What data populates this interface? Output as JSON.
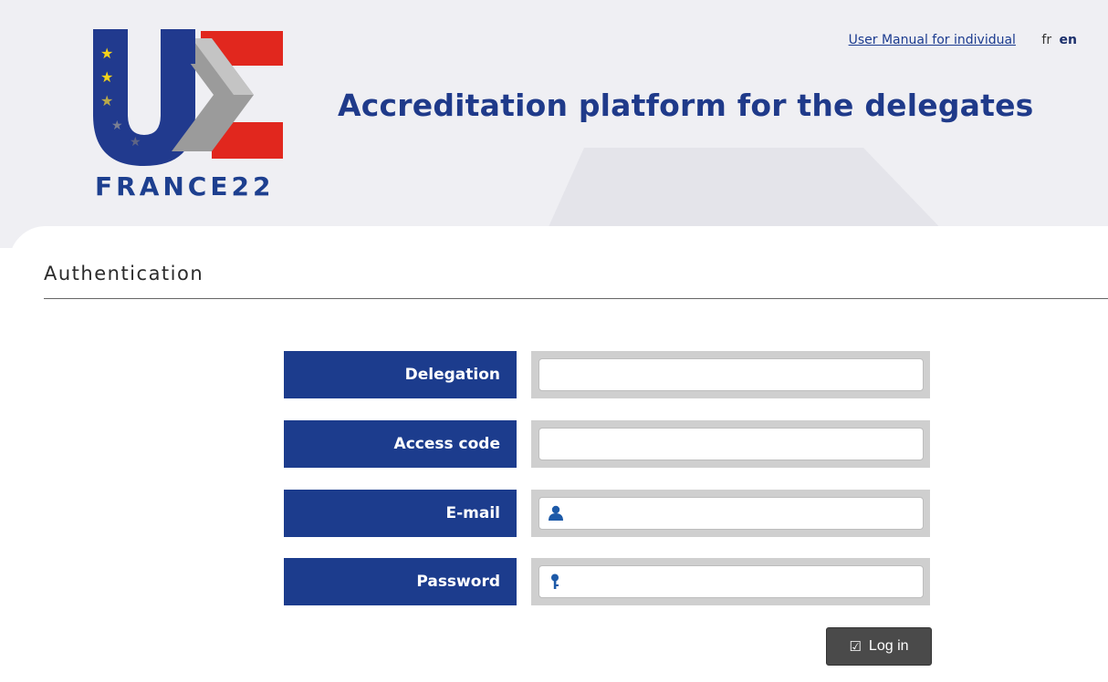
{
  "header": {
    "logo_text": "FRANCE22",
    "user_manual_link": "User Manual for individual",
    "languages": [
      "fr",
      "en"
    ],
    "active_language": "en",
    "title": "Accreditation platform for the delegates"
  },
  "section": {
    "title": "Authentication"
  },
  "form": {
    "fields": [
      {
        "label": "Delegation",
        "value": "",
        "icon": ""
      },
      {
        "label": "Access code",
        "value": "",
        "icon": ""
      },
      {
        "label": "E-mail",
        "value": "",
        "icon": "user-icon"
      },
      {
        "label": "Password",
        "value": "",
        "icon": "key-icon"
      }
    ],
    "login_button": "Log in"
  },
  "colors": {
    "brand_blue": "#1c3c8d",
    "brand_red": "#e1271e",
    "button_dark": "#4a4a4a",
    "header_bg": "#efeff3"
  }
}
